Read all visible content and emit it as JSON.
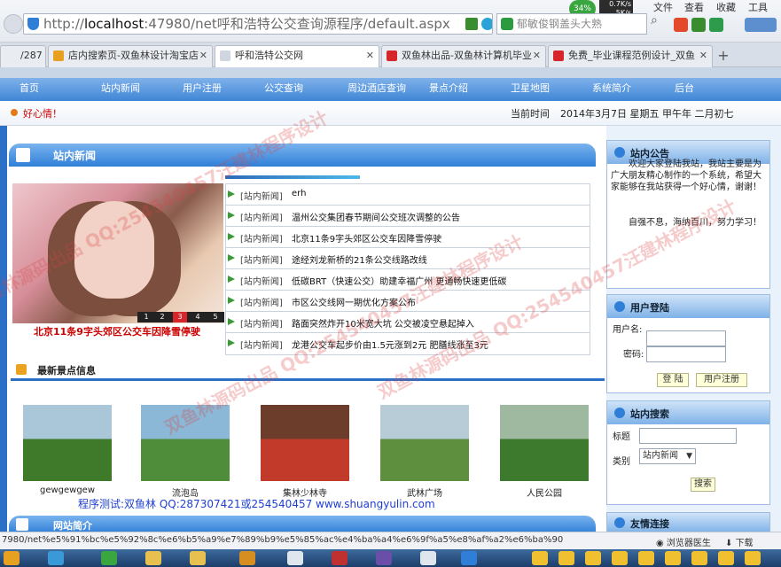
{
  "browser": {
    "url_prefix": "http://",
    "url_host": "localhost",
    "url_rest": ":47980/net呼和浩特公交查询源程序/default.aspx",
    "search_placeholder": "郁敏俊钢盖头大熟",
    "net_percent": "34%",
    "net_up": "0.7K/s",
    "net_down": "5K/s",
    "menu_file": "文件",
    "menu_view": "查看",
    "menu_fav": "收藏",
    "menu_tools": "工具"
  },
  "tabs": [
    {
      "label": "/287",
      "color": "#9aa8b8"
    },
    {
      "label": "店内搜索页-双鱼林设计淘宝店",
      "color": "#e8a020"
    },
    {
      "label": "呼和浩特公交网",
      "color": "#cfd6df"
    },
    {
      "label": "双鱼林出品-双鱼林计算机毕业",
      "color": "#d6262b"
    },
    {
      "label": "免费_毕业课程范例设计_双鱼",
      "color": "#d6262b"
    }
  ],
  "nav": {
    "items": [
      "首页",
      "站内新闻",
      "用户注册",
      "公交查询",
      "周边酒店查询",
      "景点介绍",
      "卫星地图",
      "系统简介",
      "后台"
    ]
  },
  "notice": {
    "text": "好心情！",
    "time_label": "当前时间",
    "time_value": "2014年3月7日  星期五  甲午年  二月初七"
  },
  "news": {
    "title": "站内新闻",
    "photo_caption": "北京11条9字头郊区公交车因降雪停驶",
    "photo_pages": [
      "1",
      "2",
      "3",
      "4",
      "5"
    ],
    "items": [
      {
        "cat": "[站内新闻]",
        "title": "erh"
      },
      {
        "cat": "[站内新闻]",
        "title": "温州公交集团春节期间公交班次调整的公告"
      },
      {
        "cat": "[站内新闻]",
        "title": "北京11条9字头郊区公交车因降雪停驶"
      },
      {
        "cat": "[站内新闻]",
        "title": "途经刘龙新桥的21条公交线路改线"
      },
      {
        "cat": "[站内新闻]",
        "title": "低碳BRT（快速公交）助建幸福广州  更通畅快速更低碳"
      },
      {
        "cat": "[站内新闻]",
        "title": "市区公交线网一期优化方案公布"
      },
      {
        "cat": "[站内新闻]",
        "title": "路面突然炸开10米宽大坑  公交被凌空悬起掉入"
      },
      {
        "cat": "[站内新闻]",
        "title": "龙港公交车起步价由1.5元涨到2元  肥膳线涨至3元"
      }
    ]
  },
  "scenic": {
    "title": "最新景点信息",
    "items": [
      {
        "label": "gewgewgew",
        "c1": "#3f7a2a",
        "c2": "#a9c7d9"
      },
      {
        "label": "流泡岛",
        "c1": "#4f8d3b",
        "c2": "#8ab8d6"
      },
      {
        "label": "集林少林寺",
        "c1": "#c13a2a",
        "c2": "#6b3d2a"
      },
      {
        "label": "武林广场",
        "c1": "#5d8f3e",
        "c2": "#b8ccd8"
      },
      {
        "label": "人民公园",
        "c1": "#3d7a2d",
        "c2": "#9fb8a0"
      }
    ]
  },
  "watermark_line": "程序测试:双鱼林 QQ:287307421或254540457 www.shuangyulin.com",
  "watermark_text": "双鱼林源码出品 QQ:254540457汪建林程序设计",
  "intro_title": "网站简介",
  "sidebar": {
    "announce_title": "站内公告",
    "announce_p1": "欢迎大家登陆我站，我站主要是为广大朋友精心制作的一个系统，希望大家能够在我站获得一个好心情，谢谢！",
    "announce_p2": "自强不息，海纳百川，努力学习！",
    "login_title": "用户登陆",
    "login_user_label": "用户名:",
    "login_pass_label": "密码:",
    "login_button": "登 陆",
    "register_button": "用户注册",
    "search_title": "站内搜索",
    "search_title_label": "标题",
    "search_cat_label": "类别",
    "search_cat_value": "站内新闻",
    "search_button": "搜索",
    "links_title": "友情连接"
  },
  "status": {
    "url": "7980/net%e5%91%bc%e5%92%8c%e6%b5%a9%e7%89%b9%e5%85%ac%e4%ba%a4%e6%9f%a5%e8%af%a2%e6%ba%90",
    "doctor": "浏览器医生",
    "download": "下载"
  }
}
